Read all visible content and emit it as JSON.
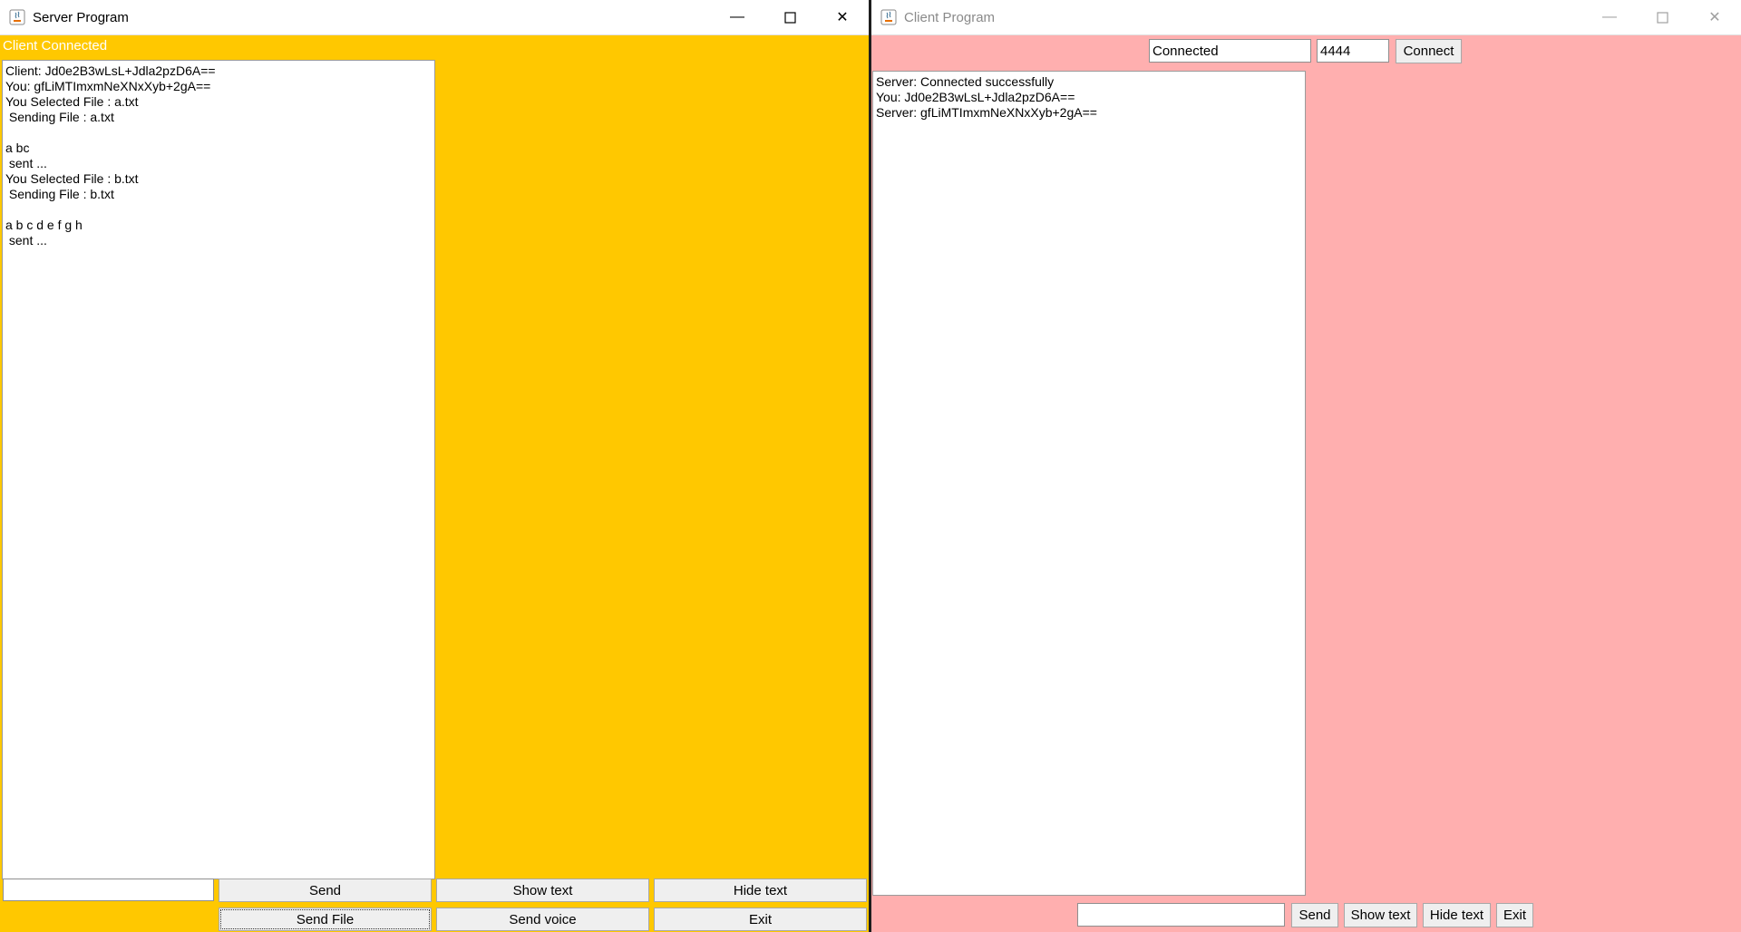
{
  "server": {
    "title": "Server Program",
    "status": "Client Connected",
    "log": [
      "Client: Jd0e2B3wLsL+Jdla2pzD6A==",
      "You: gfLiMTImxmNeXNxXyb+2gA==",
      "You Selected File : a.txt",
      " Sending File : a.txt",
      "",
      "a bc",
      " sent ...",
      "You Selected File : b.txt",
      " Sending File : b.txt",
      "",
      "a b c d e f g h",
      " sent ..."
    ],
    "message_input": "",
    "buttons": {
      "send": "Send",
      "show_text": "Show text",
      "hide_text": "Hide text",
      "send_file": "Send File",
      "send_voice": "Send voice",
      "exit": "Exit"
    },
    "colors": {
      "background": "#ffc800"
    }
  },
  "client": {
    "title": "Client Program",
    "host_field": "Connected",
    "port_field": "4444",
    "connect_label": "Connect",
    "log": [
      "Server: Connected successfully",
      "You: Jd0e2B3wLsL+Jdla2pzD6A==",
      "Server: gfLiMTImxmNeXNxXyb+2gA=="
    ],
    "message_input": "",
    "buttons": {
      "send": "Send",
      "show_text": "Show text",
      "hide_text": "Hide text",
      "exit": "Exit"
    },
    "colors": {
      "background": "#ffafaf"
    }
  }
}
